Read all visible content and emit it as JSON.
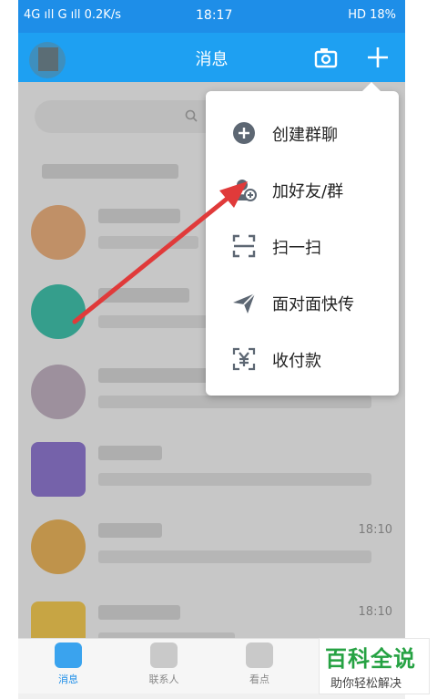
{
  "status_bar": {
    "left": "4G ıll G ıll 0.2K/s",
    "time": "18:17",
    "right": "HD 18%"
  },
  "header": {
    "title": "消息"
  },
  "popup_menu": {
    "items": [
      {
        "label": "创建群聊",
        "icon": "add-circle-icon"
      },
      {
        "label": "加好友/群",
        "icon": "add-friend-icon"
      },
      {
        "label": "扫一扫",
        "icon": "scan-icon"
      },
      {
        "label": "面对面快传",
        "icon": "paper-plane-icon"
      },
      {
        "label": "收付款",
        "icon": "yuan-icon"
      }
    ]
  },
  "chat_list": {
    "rows": [
      {
        "time": ""
      },
      {
        "time": ""
      },
      {
        "time": ""
      },
      {
        "time": ""
      },
      {
        "time": "18:10"
      },
      {
        "time": "18:10"
      }
    ]
  },
  "tabbar": {
    "tabs": [
      "消息",
      "联系人",
      "看点"
    ]
  },
  "watermark": {
    "title": "百科全说",
    "subtitle": "助你轻松解决"
  },
  "colors": {
    "header_blue": "#1ea0f2",
    "arrow_red": "#e03a3a",
    "watermark_green": "#26a243"
  }
}
